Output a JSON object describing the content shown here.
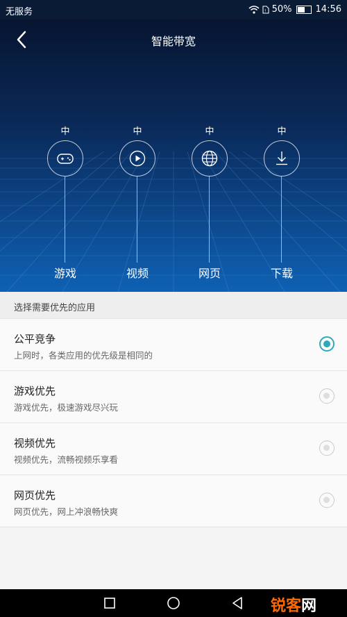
{
  "status_bar": {
    "carrier": "无服务",
    "battery": "50%",
    "time": "14:56"
  },
  "header": {
    "title": "智能带宽"
  },
  "categories": [
    {
      "level": "中",
      "name": "游戏",
      "icon": "gamepad-icon"
    },
    {
      "level": "中",
      "name": "视频",
      "icon": "play-icon"
    },
    {
      "level": "中",
      "name": "网页",
      "icon": "globe-icon"
    },
    {
      "level": "中",
      "name": "下载",
      "icon": "download-icon"
    }
  ],
  "section": {
    "header": "选择需要优先的应用"
  },
  "options": [
    {
      "title": "公平竞争",
      "desc": "上网时，各类应用的优先级是相同的",
      "selected": true
    },
    {
      "title": "游戏优先",
      "desc": "游戏优先，极速游戏尽兴玩",
      "selected": false
    },
    {
      "title": "视频优先",
      "desc": "视频优先，流畅视频乐享看",
      "selected": false
    },
    {
      "title": "网页优先",
      "desc": "网页优先，网上冲浪畅快爽",
      "selected": false
    }
  ],
  "watermark": {
    "part1": "锐客",
    "part2": "网"
  },
  "colors": {
    "accent": "#2fa9b8",
    "hero_top": "#071530",
    "hero_bottom": "#0e61b4"
  }
}
